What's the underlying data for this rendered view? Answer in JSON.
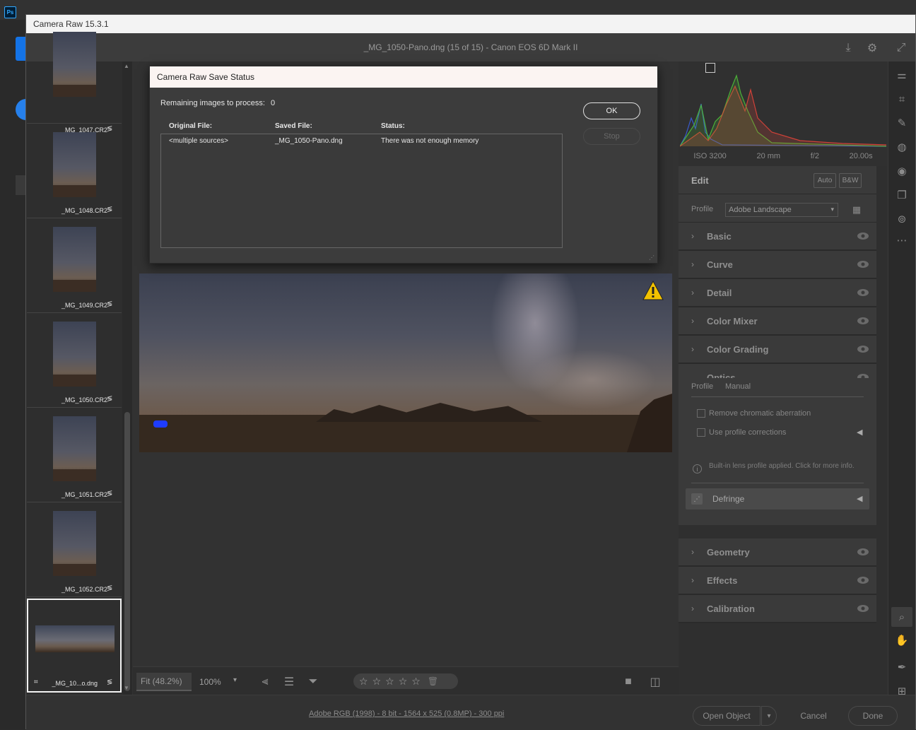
{
  "ps": {
    "logo": "Ps"
  },
  "window": {
    "title": "Camera Raw 15.3.1",
    "header": "_MG_1050-Pano.dng (15 of 15)  -  Canon EOS 6D Mark II",
    "header_icons": [
      "save-icon",
      "settings-gear-icon",
      "fullscreen-icon"
    ]
  },
  "filmstrip": {
    "items": [
      {
        "name": "_MG_1047.CR2",
        "adjusted": "≶"
      },
      {
        "name": "_MG_1048.CR2",
        "adjusted": "≶"
      },
      {
        "name": "_MG_1049.CR2",
        "adjusted": "≶"
      },
      {
        "name": "_MG_1050.CR2",
        "adjusted": "≶"
      },
      {
        "name": "_MG_1051.CR2",
        "adjusted": "≶"
      },
      {
        "name": "_MG_1052.CR2",
        "adjusted": "≶"
      }
    ],
    "selected": {
      "name": "_MG_10...o.dng",
      "crop_glyph": "⌗",
      "adjusted": "≶"
    }
  },
  "dialog": {
    "title": "Camera Raw Save Status",
    "remaining_label": "Remaining images to process:",
    "remaining_value": "0",
    "columns": {
      "original": "Original File:",
      "saved": "Saved File:",
      "status": "Status:"
    },
    "rows": [
      {
        "original": "<multiple sources>",
        "saved": "_MG_1050-Pano.dng",
        "status": "There was not enough memory"
      }
    ],
    "ok_label": "OK",
    "stop_label": "Stop"
  },
  "preview_bar": {
    "zoom_fit": "Fit (48.2%)",
    "zoom_pct": "100%",
    "stars": [
      "☆",
      "☆",
      "☆",
      "☆",
      "☆"
    ],
    "trash_glyph": "🗑"
  },
  "histogram": {
    "iso": "ISO 3200",
    "focal": "20 mm",
    "aperture": "f/2",
    "shutter": "20.00s",
    "colors": {
      "red": "#e0443a",
      "green": "#4fbf3a",
      "blue": "#3a5fe0"
    }
  },
  "edit": {
    "title": "Edit",
    "auto_label": "Auto",
    "bw_label": "B&W",
    "profile_label": "Profile",
    "profile_value": "Adobe Landscape",
    "sections_top": [
      "Basic",
      "Curve",
      "Detail",
      "Color Mixer",
      "Color Grading"
    ],
    "optics": {
      "label": "Optics",
      "tab_profile": "Profile",
      "tab_manual": "Manual",
      "remove_ca": "Remove chromatic aberration",
      "use_profile": "Use profile corrections",
      "info_text": "Built-in lens profile applied.  Click for more info.",
      "defringe": "Defringe"
    },
    "sections_bottom": [
      "Geometry",
      "Effects",
      "Calibration"
    ]
  },
  "footer": {
    "workflow": "Adobe RGB (1998) - 8 bit - 1564 x 525 (0.8MP) - 300 ppi",
    "open_object": "Open Object",
    "cancel": "Cancel",
    "done": "Done"
  }
}
